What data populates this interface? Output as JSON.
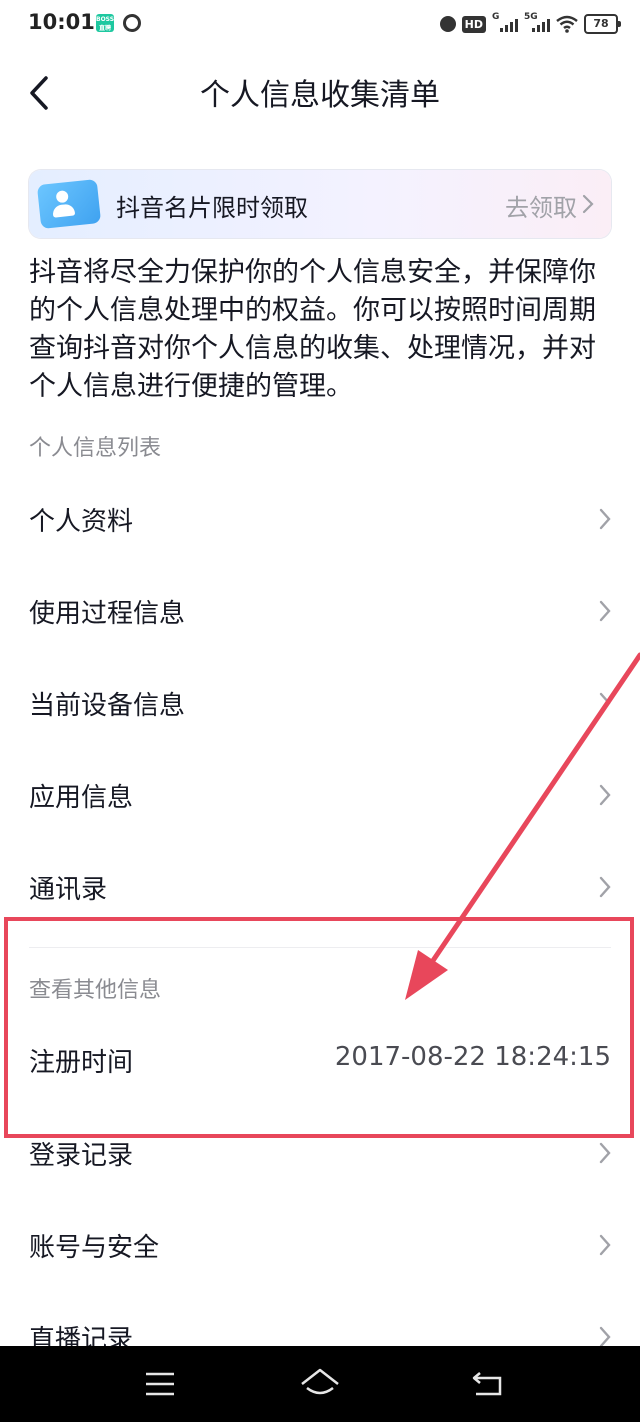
{
  "status_bar": {
    "time": "10:01",
    "app_badge_text": "BOSS直聘",
    "hd_badge": "HD",
    "signal_1_label": "G",
    "signal_2_label": "5G",
    "battery": "78"
  },
  "header": {
    "title": "个人信息收集清单"
  },
  "promo": {
    "text": "抖音名片限时领取",
    "action": "去领取"
  },
  "intro": {
    "text": "抖音将尽全力保护你的个人信息安全，并保障你的个人信息处理中的权益。你可以按照时间周期查询抖音对你个人信息的收集、处理情况，并对个人信息进行便捷的管理。"
  },
  "sections": {
    "personal_list_label": "个人信息列表",
    "other_info_label": "查看其他信息"
  },
  "personal_items": [
    {
      "label": "个人资料"
    },
    {
      "label": "使用过程信息"
    },
    {
      "label": "当前设备信息"
    },
    {
      "label": "应用信息"
    },
    {
      "label": "通讯录"
    }
  ],
  "other_items": {
    "register_time_label": "注册时间",
    "register_time_value": "2017-08-22 18:24:15",
    "login_record_label": "登录记录",
    "account_security_label": "账号与安全",
    "live_record_label": "直播记录"
  },
  "colors": {
    "highlight": "#e8475b",
    "text_primary": "#161823",
    "text_secondary": "#8a8b91"
  },
  "icons": [
    "back-arrow-icon",
    "id-card-icon",
    "chevron-right-icon",
    "menu-icon",
    "home-icon",
    "back-icon"
  ]
}
